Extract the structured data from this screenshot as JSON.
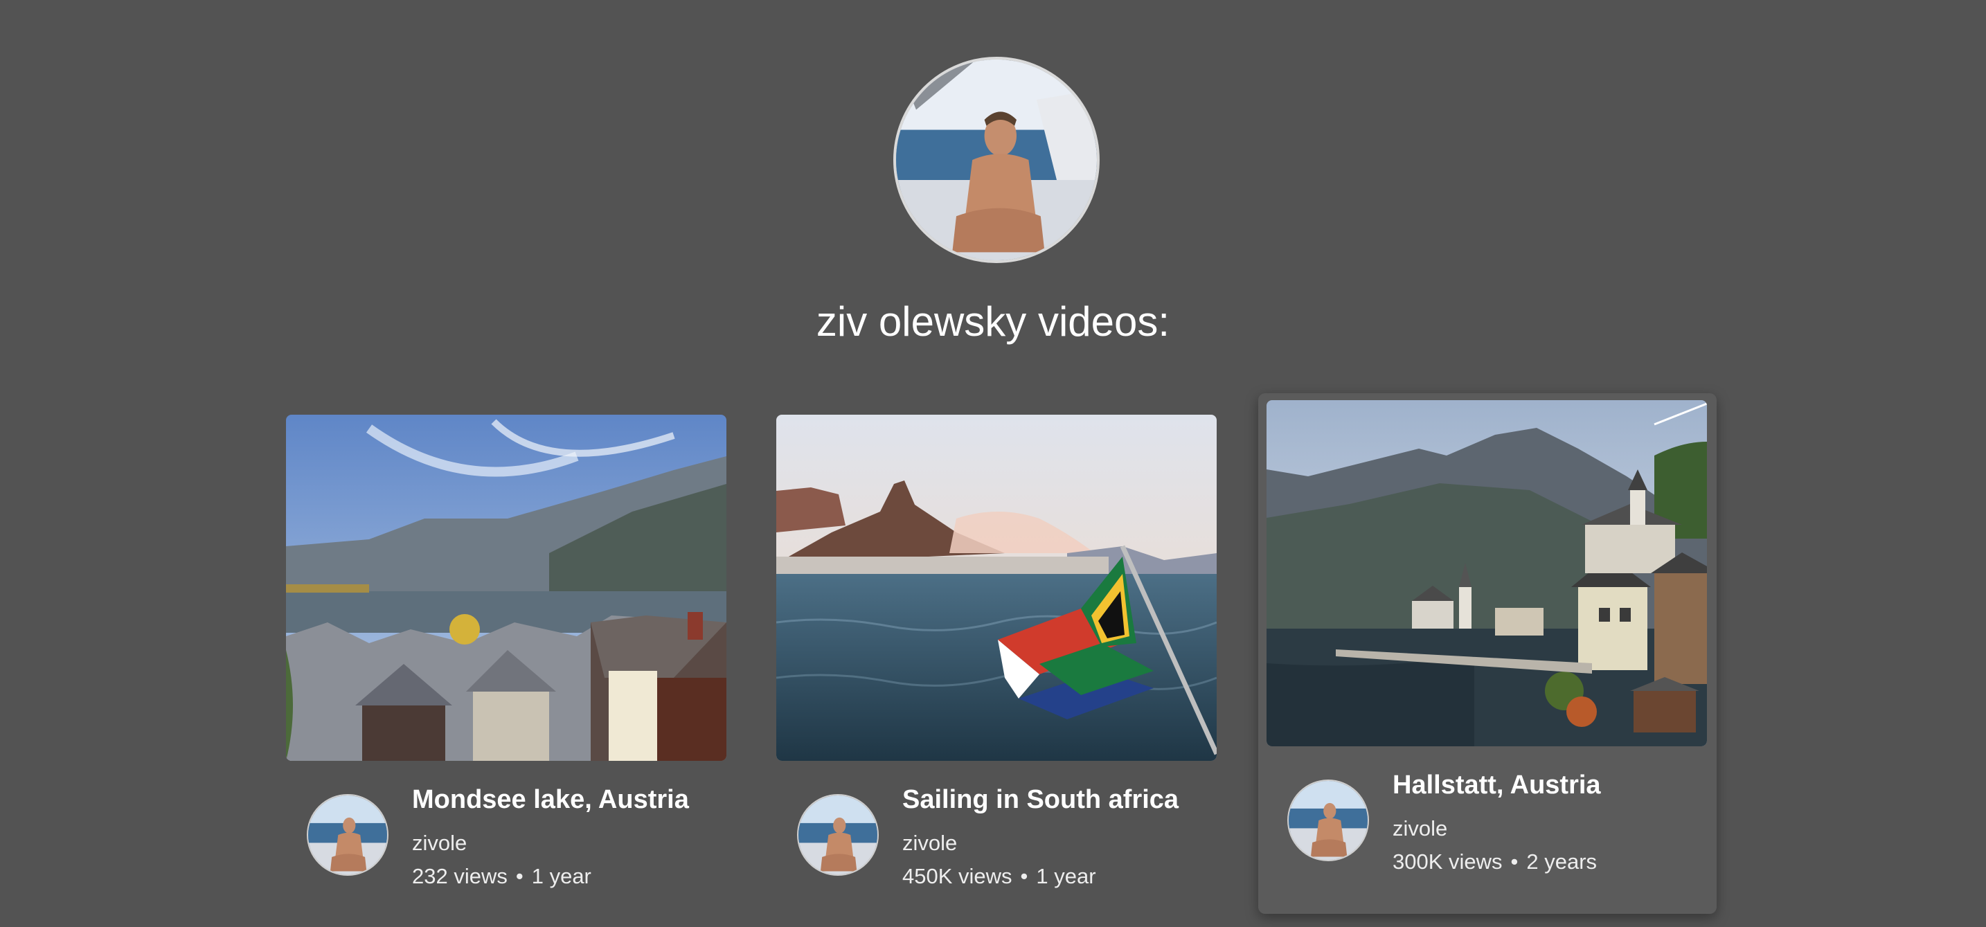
{
  "profile": {
    "avatar_icon": "profile-photo-man-on-sailboat"
  },
  "heading": "ziv olewsky videos:",
  "videos": [
    {
      "title": "Mondsee lake, Austria",
      "channel": "zivole",
      "views": "232 views",
      "age": "1 year",
      "thumbnail": "lake-village-mountains"
    },
    {
      "title": "Sailing in South africa",
      "channel": "zivole",
      "views": "450K views",
      "age": "1 year",
      "thumbnail": "south-africa-flag-sea"
    },
    {
      "title": "Hallstatt, Austria",
      "channel": "zivole",
      "views": "300K views",
      "age": "2 years",
      "thumbnail": "hallstatt-lakeside-village"
    }
  ],
  "separator": "•",
  "colors": {
    "background": "#535353",
    "card_hover": "#5b5b5b",
    "text": "#ffffff"
  }
}
